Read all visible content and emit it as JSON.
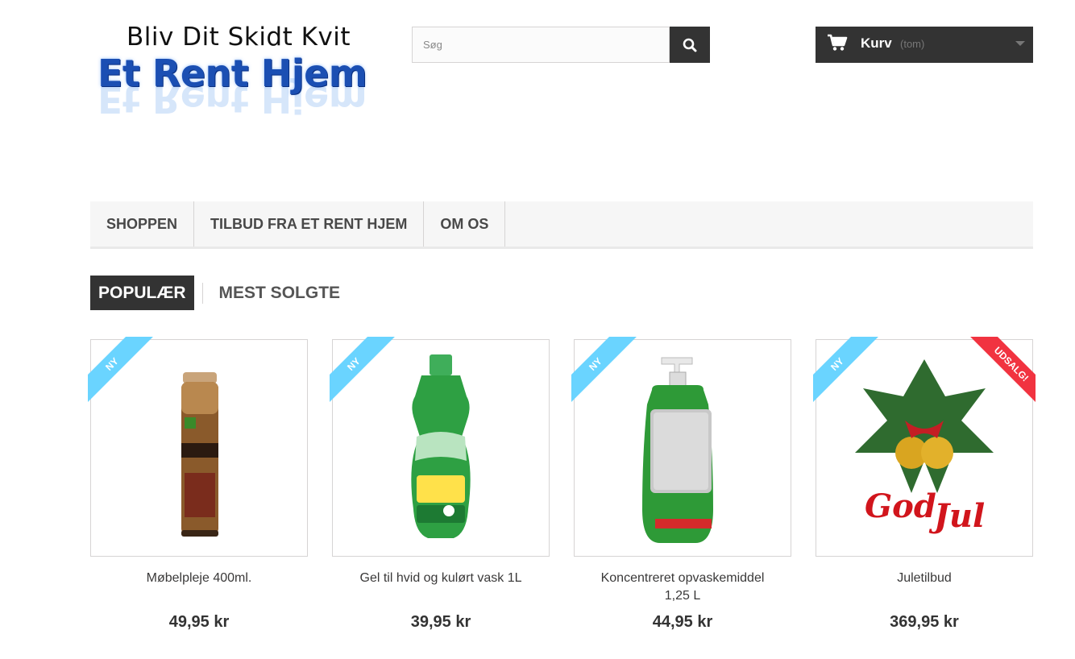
{
  "logo": {
    "line1": "Bliv Dit Skidt Kvit",
    "line2": "Et Rent Hjem"
  },
  "search": {
    "placeholder": "Søg",
    "icon": "search-icon"
  },
  "cart": {
    "label": "Kurv",
    "status": "(tom)",
    "icon": "shopping-cart-icon"
  },
  "menu": {
    "items": [
      {
        "label": "Shoppen"
      },
      {
        "label": "Tilbud fra Et Rent Hjem"
      },
      {
        "label": "Om os"
      }
    ]
  },
  "tabs": [
    {
      "label": "Populær",
      "active": true
    },
    {
      "label": "Mest solgte",
      "active": false
    }
  ],
  "products": [
    {
      "name": "Møbelpleje 400ml.",
      "price": "49,95 kr",
      "badge": "Ny"
    },
    {
      "name": "Gel til hvid og kulørt vask 1L",
      "price": "39,95 kr",
      "badge": "Ny"
    },
    {
      "name": "Koncentreret opvaskemiddel 1,25 L",
      "price": "44,95 kr",
      "badge": "Ny"
    },
    {
      "name": "Juletilbud",
      "price": "369,95 kr",
      "badge": "Ny",
      "sale_badge": "Udsalg!"
    }
  ],
  "colors": {
    "dark": "#333333",
    "new_ribbon": "#6ad4ff",
    "sale_ribbon": "#f13340"
  }
}
